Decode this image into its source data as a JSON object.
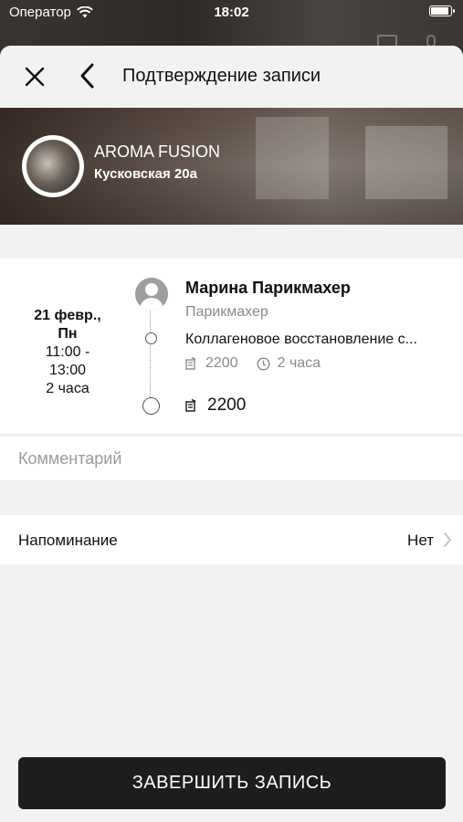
{
  "status_bar": {
    "carrier": "Оператор",
    "time": "18:02"
  },
  "header": {
    "title": "Подтверждение записи"
  },
  "salon": {
    "name": "AROMA FUSION",
    "address": "Кусковская 20а"
  },
  "appointment": {
    "date_line1": "21 февр.,",
    "date_line2": "Пн",
    "time_start": "11:00 -",
    "time_end": "13:00",
    "duration": "2 часа"
  },
  "master": {
    "name": "Марина Парикмахер",
    "role": "Парикмахер"
  },
  "service": {
    "name": "Коллагеновое восстановление с...",
    "price": "2200",
    "duration": "2 часа"
  },
  "total": {
    "price": "2200"
  },
  "comment": {
    "placeholder": "Комментарий",
    "value": ""
  },
  "reminder": {
    "label": "Напоминание",
    "value": "Нет"
  },
  "actions": {
    "submit_label": "ЗАВЕРШИТЬ ЗАПИСЬ"
  },
  "colors": {
    "button_bg": "#1f1c1c",
    "sheet_bg": "#f2f2f2",
    "muted_text": "#8a8a8a"
  }
}
